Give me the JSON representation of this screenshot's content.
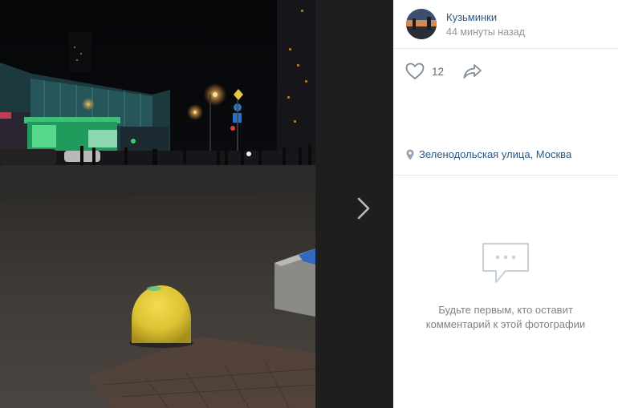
{
  "post": {
    "author_name": "Кузьминки",
    "time_ago": "44 минуты назад",
    "likes_count": "12",
    "location": "Зеленодольская улица, Москва"
  },
  "comments": {
    "empty_line1": "Будьте первым, кто оставит",
    "empty_line2": "комментарий к этой фотографии"
  },
  "icons": {
    "like": "heart-outline-icon",
    "share": "share-arrow-icon",
    "location": "map-pin-icon",
    "next": "chevron-right-icon",
    "comments_empty": "speech-bubble-icon"
  },
  "colors": {
    "link": "#2a5885",
    "muted": "#939393",
    "icon": "#828a99",
    "viewer_bg": "#0a0a0a"
  }
}
